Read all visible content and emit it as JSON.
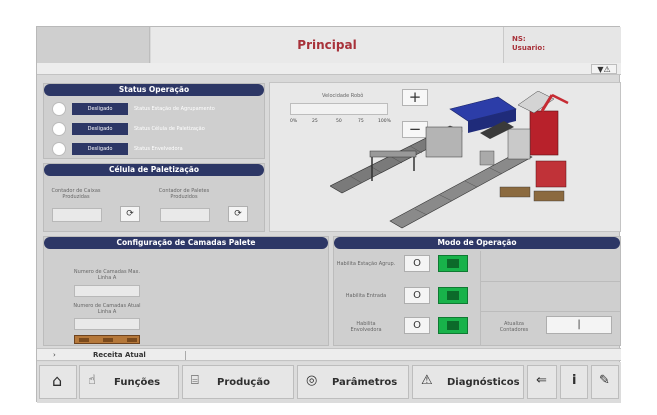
{
  "header": {
    "title": "Principal",
    "ns_label": "NS:",
    "user_label": "Usuario:"
  },
  "alarm": {
    "icon": "filter-alarm-icon",
    "glyph": "▼⚠"
  },
  "status_operacao": {
    "title": "Status Operação",
    "rows": [
      {
        "state": "Desligado",
        "label": "Status Estação de Agrupamento"
      },
      {
        "state": "Desligado",
        "label": "Status Célula de Paletização"
      },
      {
        "state": "Desligado",
        "label": "Status Envelvedora"
      }
    ]
  },
  "celula": {
    "title": "Célula de Paletização",
    "counter_boxes": "Contador de Caixas Produzidas",
    "counter_pallets": "Contador de Paletes Produzidos"
  },
  "robot": {
    "speed_label": "Velocidade Robô",
    "ticks": [
      "0%",
      "25",
      "50",
      "75",
      "100%"
    ],
    "plus": "+",
    "minus": "−"
  },
  "camadas": {
    "title": "Configuração de Camadas Palete",
    "max_layers": "Numero de Camadas Max. Linha A",
    "cur_layers": "Numero de Camadas Atual Linha A"
  },
  "modo": {
    "title": "Modo de Operação",
    "items": [
      {
        "label": "Habilita Estação Agrup."
      },
      {
        "label": "Habilita Entrada"
      },
      {
        "label": "Habilita Envolvedora"
      }
    ],
    "toggle_off": "O",
    "update_label": "Atualiza Contadores",
    "update_glyph": "|"
  },
  "footer": {
    "recipe": "Receita Atual",
    "arrow": "›"
  },
  "nav": {
    "home_glyph": "⌂",
    "functions": "Funções",
    "production": "Produção",
    "parameters": "Parâmetros",
    "diagnostics": "Diagnósticos",
    "back_glyph": "⇐",
    "person_glyph": "i",
    "wrench_glyph": "✎"
  }
}
